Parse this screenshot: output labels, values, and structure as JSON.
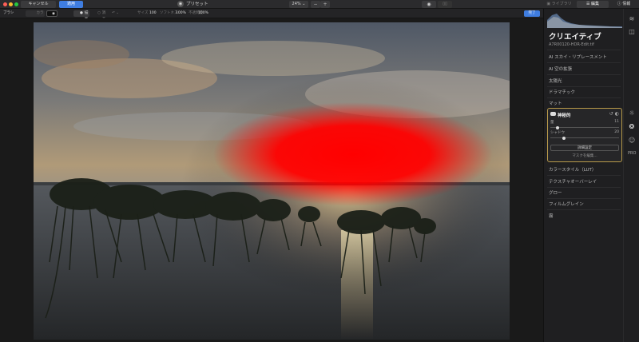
{
  "titlebar": {
    "cancel_label": "キャンセル",
    "apply_label": "適用",
    "preset_label": "プリセット",
    "zoom_value": "24%",
    "tabs": {
      "library": "ライブラリ",
      "edit": "編集",
      "info": "情報"
    }
  },
  "toolbar": {
    "brush_label": "ブラシ",
    "erase_label": "カラー",
    "paint_label": "描画",
    "erase2_label": "消去",
    "size_label": "サイズ",
    "size_value": "100",
    "softness_label": "ソフトネス",
    "softness_value": "100%",
    "opacity_label": "不透明度",
    "opacity_value": "100%",
    "done_label": "完了"
  },
  "panel": {
    "title": "クリエイティブ",
    "filename": "A7R00120-HDR-Edit.tif",
    "items_top": [
      "AI スカイ・リプレースメント",
      "AI 空の拡張",
      "太陽光",
      "ドラマチック",
      "マット"
    ],
    "active": {
      "title": "神秘的",
      "sliders": [
        {
          "label": "量",
          "value": "11",
          "level": 0.11
        },
        {
          "label": "シャドウ",
          "value": "20",
          "level": 0.2
        }
      ],
      "detail_button": "詳細設定",
      "mask_link": "マスクを編集..."
    },
    "items_bottom": [
      "カラースタイル（LUT）",
      "テクスチャオーバーレイ",
      "グロー",
      "フィルムグレイン",
      "霧"
    ]
  },
  "colors": {
    "accent": "#3f7de0",
    "active_border": "#b89a4a",
    "mask_overlay": "#ff0000"
  },
  "icons": {
    "layers": "layers-icon",
    "compare": "compare-icon",
    "sun": "sun-icon",
    "palette": "palette-icon",
    "face": "face-icon",
    "pro": "pro-icon"
  }
}
